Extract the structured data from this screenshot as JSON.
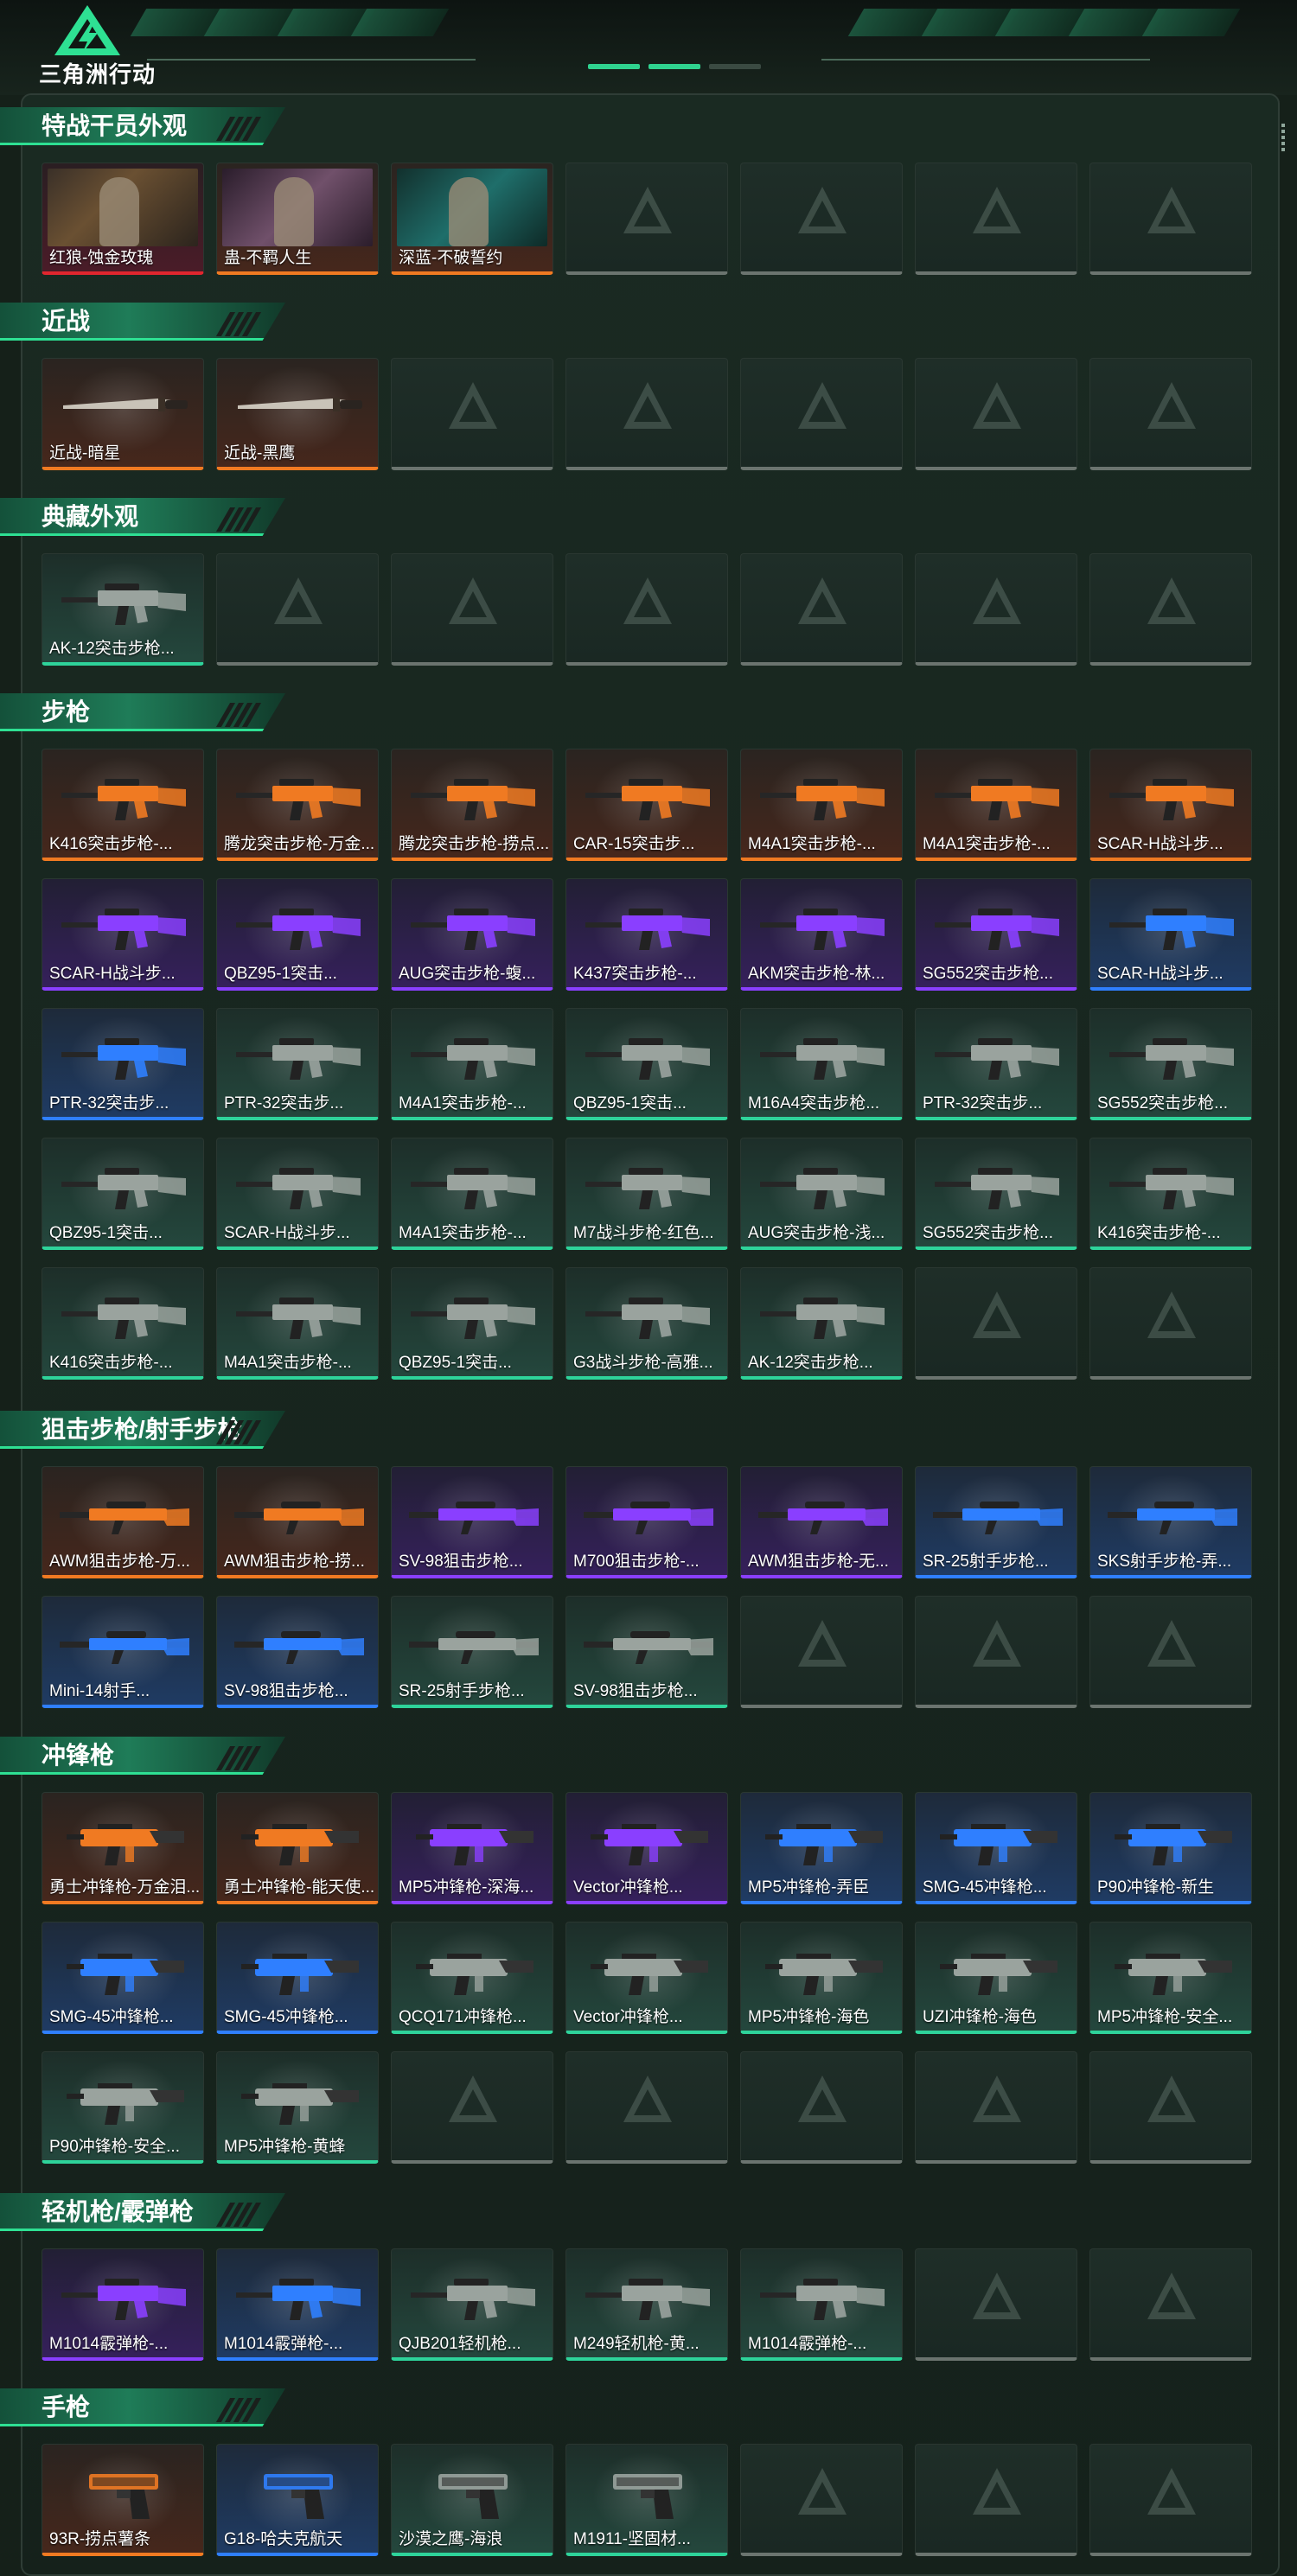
{
  "app": {
    "title": "三角洲行动"
  },
  "colors": {
    "orange": "#f07a22",
    "purple": "#8a3fff",
    "blue": "#2f7fff",
    "green": "#2ed39a",
    "red": "#e0262e",
    "accent": "#2ee093"
  },
  "sections": [
    {
      "title": "特战干员外观",
      "items": [
        {
          "label": "红狼-蚀金玫瑰",
          "rarity": "red",
          "kind": "operator"
        },
        {
          "label": "蛊-不羁人生",
          "rarity": "orange",
          "kind": "operator"
        },
        {
          "label": "深蓝-不破誓约",
          "rarity": "orange",
          "kind": "operator"
        }
      ]
    },
    {
      "title": "近战",
      "items": [
        {
          "label": "近战-暗星",
          "rarity": "orange",
          "kind": "knife"
        },
        {
          "label": "近战-黑鹰",
          "rarity": "orange",
          "kind": "knife"
        }
      ]
    },
    {
      "title": "典藏外观",
      "items": [
        {
          "label": "AK-12突击步枪...",
          "rarity": "green",
          "kind": "rifle"
        }
      ]
    },
    {
      "title": "步枪",
      "items": [
        {
          "label": "K416突击步枪-...",
          "rarity": "orange",
          "kind": "rifle"
        },
        {
          "label": "腾龙突击步枪-万金...",
          "rarity": "orange",
          "kind": "rifle"
        },
        {
          "label": "腾龙突击步枪-捞点...",
          "rarity": "orange",
          "kind": "rifle"
        },
        {
          "label": "CAR-15突击步...",
          "rarity": "orange",
          "kind": "rifle"
        },
        {
          "label": "M4A1突击步枪-...",
          "rarity": "orange",
          "kind": "rifle"
        },
        {
          "label": "M4A1突击步枪-...",
          "rarity": "orange",
          "kind": "rifle"
        },
        {
          "label": "SCAR-H战斗步...",
          "rarity": "orange",
          "kind": "rifle"
        },
        {
          "label": "SCAR-H战斗步...",
          "rarity": "purple",
          "kind": "rifle"
        },
        {
          "label": "QBZ95-1突击...",
          "rarity": "purple",
          "kind": "rifle"
        },
        {
          "label": "AUG突击步枪-蝮...",
          "rarity": "purple",
          "kind": "rifle"
        },
        {
          "label": "K437突击步枪-...",
          "rarity": "purple",
          "kind": "rifle"
        },
        {
          "label": "AKM突击步枪-林...",
          "rarity": "purple",
          "kind": "rifle"
        },
        {
          "label": "SG552突击步枪...",
          "rarity": "purple",
          "kind": "rifle"
        },
        {
          "label": "SCAR-H战斗步...",
          "rarity": "blue",
          "kind": "rifle"
        },
        {
          "label": "PTR-32突击步...",
          "rarity": "blue",
          "kind": "rifle"
        },
        {
          "label": "PTR-32突击步...",
          "rarity": "green",
          "kind": "rifle"
        },
        {
          "label": "M4A1突击步枪-...",
          "rarity": "green",
          "kind": "rifle"
        },
        {
          "label": "QBZ95-1突击...",
          "rarity": "green",
          "kind": "rifle"
        },
        {
          "label": "M16A4突击步枪...",
          "rarity": "green",
          "kind": "rifle"
        },
        {
          "label": "PTR-32突击步...",
          "rarity": "green",
          "kind": "rifle"
        },
        {
          "label": "SG552突击步枪...",
          "rarity": "green",
          "kind": "rifle"
        },
        {
          "label": "QBZ95-1突击...",
          "rarity": "green",
          "kind": "rifle"
        },
        {
          "label": "SCAR-H战斗步...",
          "rarity": "green",
          "kind": "rifle"
        },
        {
          "label": "M4A1突击步枪-...",
          "rarity": "green",
          "kind": "rifle"
        },
        {
          "label": "M7战斗步枪-红色...",
          "rarity": "green",
          "kind": "rifle"
        },
        {
          "label": "AUG突击步枪-浅...",
          "rarity": "green",
          "kind": "rifle"
        },
        {
          "label": "SG552突击步枪...",
          "rarity": "green",
          "kind": "rifle"
        },
        {
          "label": "K416突击步枪-...",
          "rarity": "green",
          "kind": "rifle"
        },
        {
          "label": "K416突击步枪-...",
          "rarity": "green",
          "kind": "rifle"
        },
        {
          "label": "M4A1突击步枪-...",
          "rarity": "green",
          "kind": "rifle"
        },
        {
          "label": "QBZ95-1突击...",
          "rarity": "green",
          "kind": "rifle"
        },
        {
          "label": "G3战斗步枪-高雅...",
          "rarity": "green",
          "kind": "rifle"
        },
        {
          "label": "AK-12突击步枪...",
          "rarity": "green",
          "kind": "rifle"
        }
      ]
    },
    {
      "title": "狙击步枪/射手步枪",
      "items": [
        {
          "label": "AWM狙击步枪-万...",
          "rarity": "orange",
          "kind": "sniper"
        },
        {
          "label": "AWM狙击步枪-捞...",
          "rarity": "orange",
          "kind": "sniper"
        },
        {
          "label": "SV-98狙击步枪...",
          "rarity": "purple",
          "kind": "sniper"
        },
        {
          "label": "M700狙击步枪-...",
          "rarity": "purple",
          "kind": "sniper"
        },
        {
          "label": "AWM狙击步枪-无...",
          "rarity": "purple",
          "kind": "sniper"
        },
        {
          "label": "SR-25射手步枪...",
          "rarity": "blue",
          "kind": "sniper"
        },
        {
          "label": "SKS射手步枪-弄...",
          "rarity": "blue",
          "kind": "sniper"
        },
        {
          "label": "Mini-14射手...",
          "rarity": "blue",
          "kind": "sniper"
        },
        {
          "label": "SV-98狙击步枪...",
          "rarity": "blue",
          "kind": "sniper"
        },
        {
          "label": "SR-25射手步枪...",
          "rarity": "green",
          "kind": "sniper"
        },
        {
          "label": "SV-98狙击步枪...",
          "rarity": "green",
          "kind": "sniper"
        }
      ]
    },
    {
      "title": "冲锋枪",
      "items": [
        {
          "label": "勇士冲锋枪-万金泪...",
          "rarity": "orange",
          "kind": "smg"
        },
        {
          "label": "勇士冲锋枪-能天使...",
          "rarity": "orange",
          "kind": "smg"
        },
        {
          "label": "MP5冲锋枪-深海...",
          "rarity": "purple",
          "kind": "smg"
        },
        {
          "label": "Vector冲锋枪...",
          "rarity": "purple",
          "kind": "smg"
        },
        {
          "label": "MP5冲锋枪-弄臣",
          "rarity": "blue",
          "kind": "smg"
        },
        {
          "label": "SMG-45冲锋枪...",
          "rarity": "blue",
          "kind": "smg"
        },
        {
          "label": "P90冲锋枪-新生",
          "rarity": "blue",
          "kind": "smg"
        },
        {
          "label": "SMG-45冲锋枪...",
          "rarity": "blue",
          "kind": "smg"
        },
        {
          "label": "SMG-45冲锋枪...",
          "rarity": "blue",
          "kind": "smg"
        },
        {
          "label": "QCQ171冲锋枪...",
          "rarity": "green",
          "kind": "smg"
        },
        {
          "label": "Vector冲锋枪...",
          "rarity": "green",
          "kind": "smg"
        },
        {
          "label": "MP5冲锋枪-海色",
          "rarity": "green",
          "kind": "smg"
        },
        {
          "label": "UZI冲锋枪-海色",
          "rarity": "green",
          "kind": "smg"
        },
        {
          "label": "MP5冲锋枪-安全...",
          "rarity": "green",
          "kind": "smg"
        },
        {
          "label": "P90冲锋枪-安全...",
          "rarity": "green",
          "kind": "smg"
        },
        {
          "label": "MP5冲锋枪-黄蜂",
          "rarity": "green",
          "kind": "smg"
        }
      ]
    },
    {
      "title": "轻机枪/霰弹枪",
      "items": [
        {
          "label": "M1014霰弹枪-...",
          "rarity": "purple",
          "kind": "shotgun"
        },
        {
          "label": "M1014霰弹枪-...",
          "rarity": "blue",
          "kind": "shotgun"
        },
        {
          "label": "QJB201轻机枪...",
          "rarity": "green",
          "kind": "lmg"
        },
        {
          "label": "M249轻机枪-黄...",
          "rarity": "green",
          "kind": "lmg"
        },
        {
          "label": "M1014霰弹枪-...",
          "rarity": "green",
          "kind": "shotgun"
        }
      ]
    },
    {
      "title": "手枪",
      "items": [
        {
          "label": "93R-捞点薯条",
          "rarity": "orange",
          "kind": "pistol"
        },
        {
          "label": "G18-哈夫克航天",
          "rarity": "blue",
          "kind": "pistol"
        },
        {
          "label": "沙漠之鹰-海浪",
          "rarity": "green",
          "kind": "pistol"
        },
        {
          "label": "M1911-坚固材...",
          "rarity": "green",
          "kind": "pistol"
        }
      ]
    }
  ]
}
